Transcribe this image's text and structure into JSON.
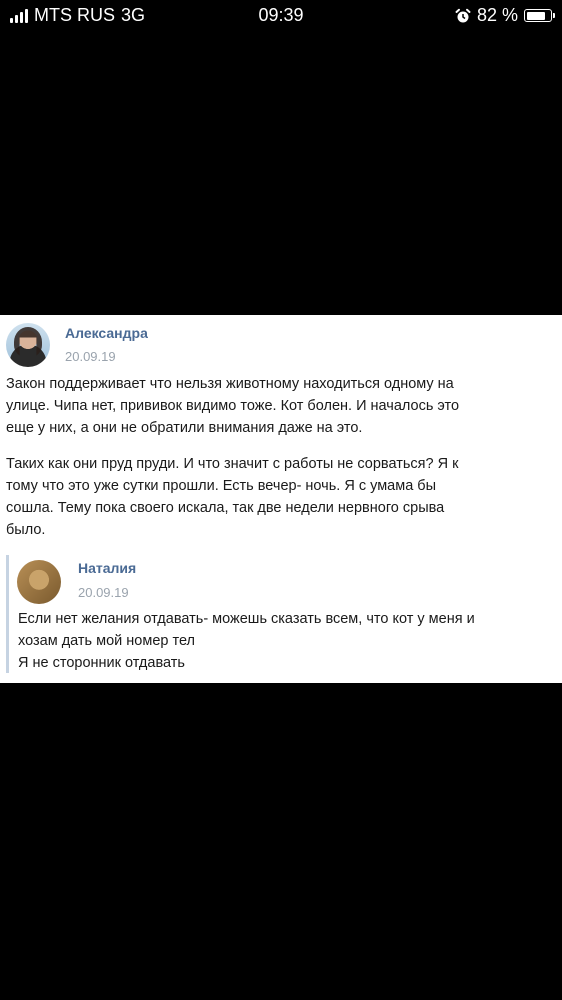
{
  "status_bar": {
    "carrier": "MTS RUS",
    "network": "3G",
    "time": "09:39",
    "battery": "82 %",
    "battery_level": 0.82
  },
  "comment": {
    "author": "Александра",
    "date": "20.09.19",
    "paragraph1_lines": [
      "Закон поддерживает что нельзя животному находиться одному на",
      "улице. Чипа нет, прививок видимо тоже. Кот болен. И началось это",
      "еще у них, а они не обратили внимания даже на это."
    ],
    "paragraph2_lines": [
      "Таких как они пруд пруди. И что значит с работы не сорваться? Я к",
      "тому что это уже сутки прошли. Есть вечер- ночь. Я с умама бы",
      "сошла. Тему пока своего искала, так две недели нервного срыва",
      "было."
    ]
  },
  "quoted": {
    "author": "Наталия",
    "date": "20.09.19",
    "lines": [
      "Если нет желания отдавать- можешь сказать всем, что кот у меня и",
      "хозам дать мой номер тел",
      "Я не сторонник отдавать"
    ]
  }
}
